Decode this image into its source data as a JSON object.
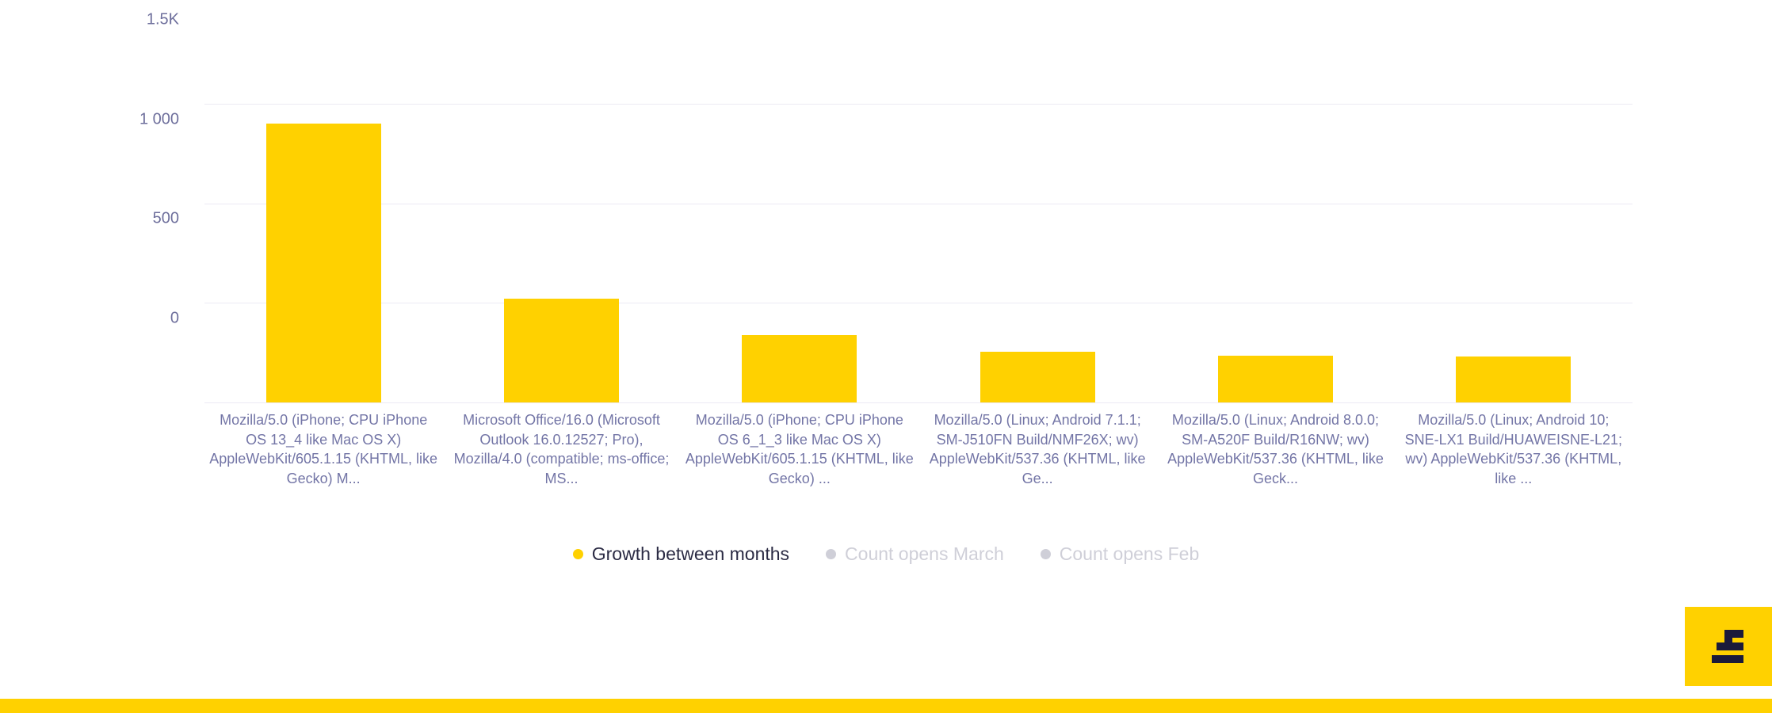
{
  "chart_data": {
    "type": "bar",
    "title": "",
    "xlabel": "",
    "ylabel": "",
    "ylim": [
      0,
      1600
    ],
    "grid": true,
    "legend_position": "bottom",
    "y_ticks": [
      {
        "value": 1500,
        "label": "1.5K"
      },
      {
        "value": 1000,
        "label": "1 000"
      },
      {
        "value": 500,
        "label": "500"
      },
      {
        "value": 0,
        "label": "0"
      }
    ],
    "categories": [
      "Mozilla/5.0 (iPhone; CPU iPhone OS 13_4 like Mac OS X) AppleWebKit/605.1.15 (KHTML, like Gecko) M...",
      "Microsoft Office/16.0 (Microsoft Outlook 16.0.12527; Pro), Mozilla/4.0 (compatible; ms-office; MS...",
      "Mozilla/5.0 (iPhone; CPU iPhone OS 6_1_3 like Mac OS X) AppleWebKit/605.1.15 (KHTML, like Gecko) ...",
      "Mozilla/5.0 (Linux; Android 7.1.1; SM-J510FN Build/NMF26X; wv) AppleWebKit/537.36 (KHTML, like Ge...",
      "Mozilla/5.0 (Linux; Android 8.0.0; SM-A520F Build/R16NW; wv) AppleWebKit/537.36 (KHTML, like Geck...",
      "Mozilla/5.0 (Linux; Android 10; SNE-LX1 Build/HUAWEISNE-L21; wv) AppleWebKit/537.36 (KHTML, like ..."
    ],
    "series": [
      {
        "name": "Growth between months",
        "color": "#ffd100",
        "active": true,
        "values": [
          1400,
          520,
          340,
          255,
          235,
          232
        ]
      },
      {
        "name": "Count opens March",
        "color": "#cfcfd8",
        "active": false,
        "values": []
      },
      {
        "name": "Count opens Feb",
        "color": "#cfcfd8",
        "active": false,
        "values": []
      }
    ]
  },
  "legend": [
    {
      "label": "Growth between months",
      "state": "active"
    },
    {
      "label": "Count opens March",
      "state": "muted"
    },
    {
      "label": "Count opens Feb",
      "state": "muted"
    }
  ],
  "branding": {
    "logo_icon": "stepped-e-logo-icon",
    "badge_color": "#ffd100",
    "glyph_color": "#1b1a3a",
    "footer_color": "#ffd100"
  },
  "colors": {
    "bar": "#ffd100",
    "gridline": "#eceaf4",
    "axis_text": "#6e6f9c",
    "category_text": "#7375a6",
    "legend_active_text": "#2b2b44",
    "legend_muted_text": "#cfcfd8",
    "background": "#ffffff"
  }
}
